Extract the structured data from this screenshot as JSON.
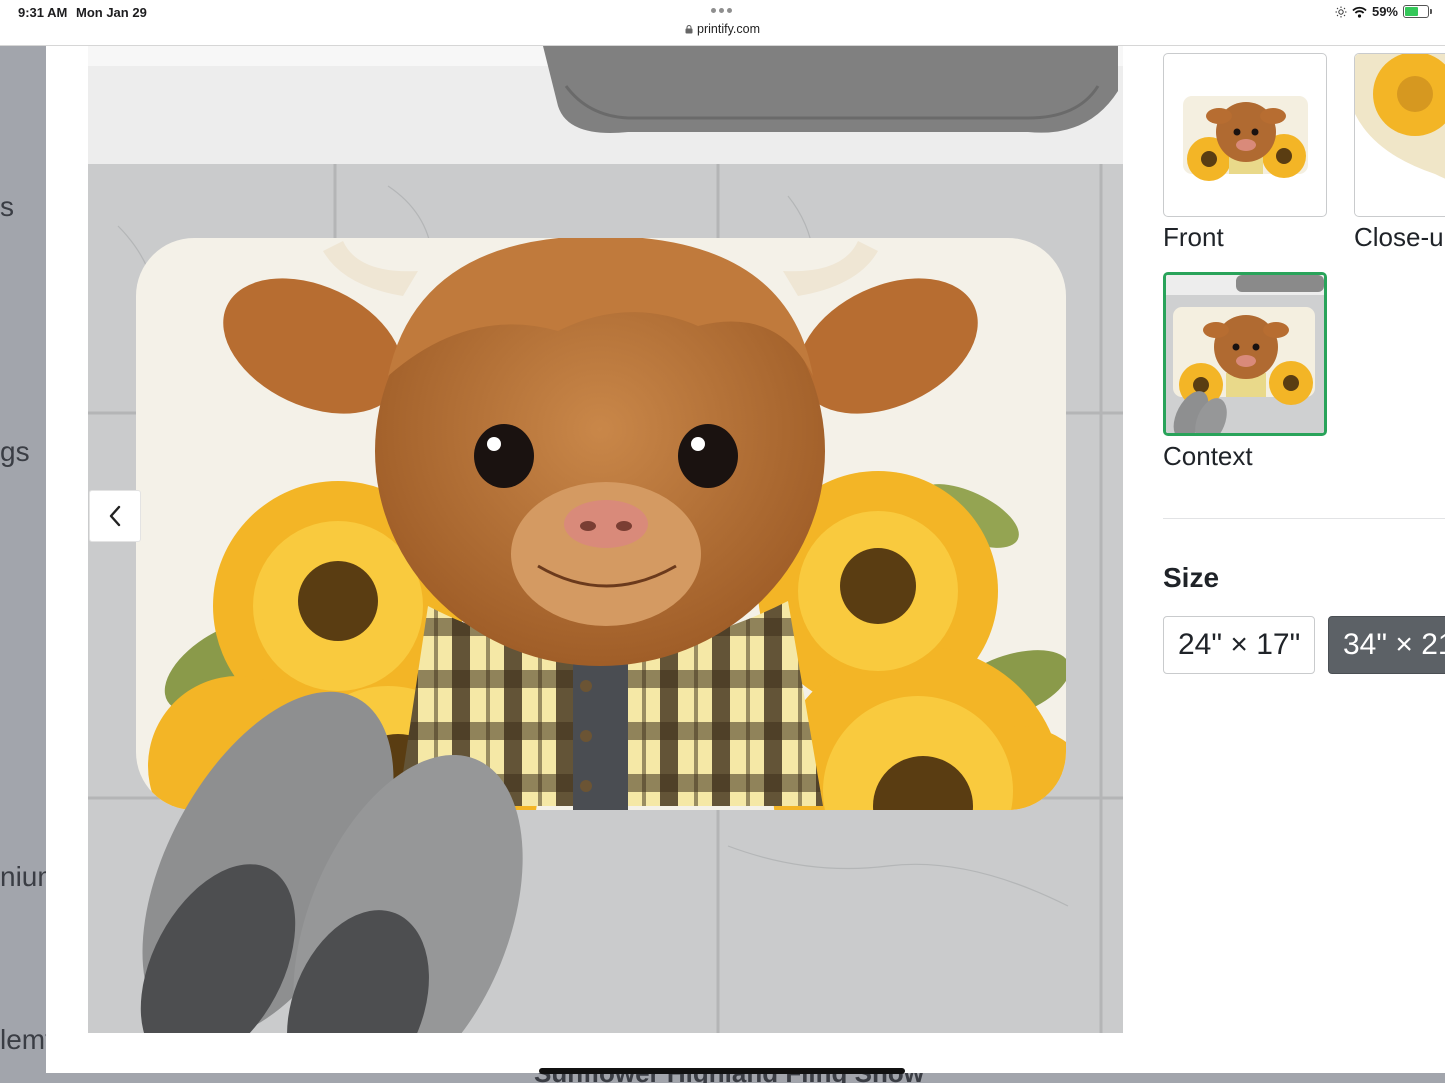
{
  "status_bar": {
    "time": "9:31 AM",
    "date": "Mon Jan 29",
    "url": "printify.com",
    "battery_percent": "59%",
    "battery_level": 0.59
  },
  "background_page": {
    "fragments": [
      "s",
      "gs",
      "nium",
      "lemy"
    ],
    "caption": "Sunflower Highland Fling Show"
  },
  "viewer": {
    "prev_icon": "chevron-left-icon",
    "main_image_icon": "highland-cow-bath-mat-photo"
  },
  "thumbnails": [
    {
      "label": "Front",
      "selected": false
    },
    {
      "label": "Close-u",
      "selected": false
    },
    {
      "label": "Context",
      "selected": true
    }
  ],
  "size": {
    "title": "Size",
    "options": [
      {
        "label": "24\" × 17\"",
        "selected": false
      },
      {
        "label": "34\" × 21",
        "selected": true
      }
    ]
  },
  "colors": {
    "selected_border": "#29a35a",
    "selected_size_bg": "#5c6166"
  }
}
